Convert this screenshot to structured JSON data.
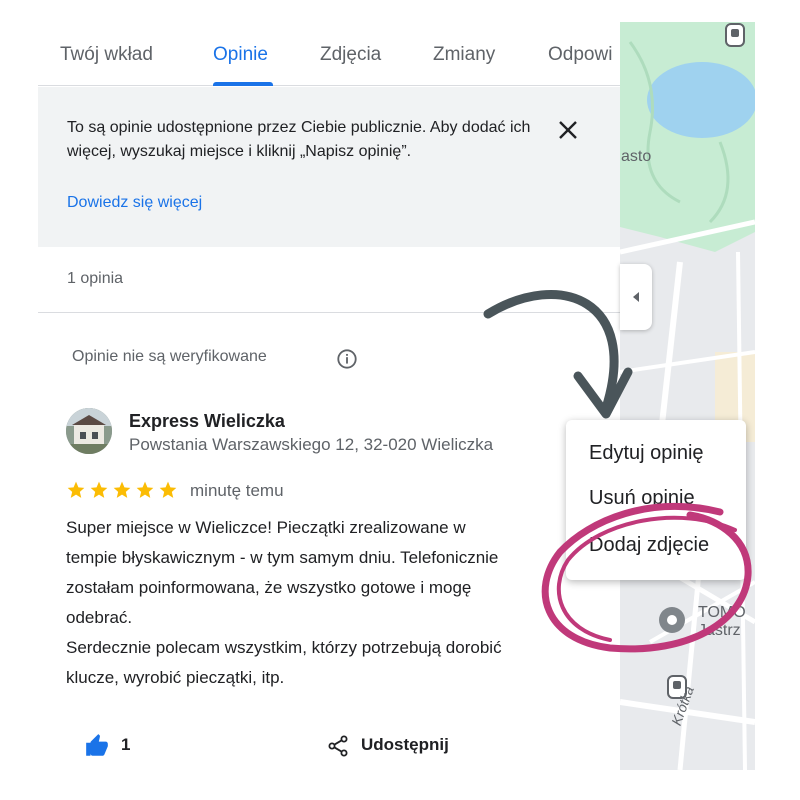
{
  "tabs": [
    {
      "label": "Twój wkład"
    },
    {
      "label": "Opinie"
    },
    {
      "label": "Zdjęcia"
    },
    {
      "label": "Zmiany"
    },
    {
      "label": "Odpowi"
    }
  ],
  "active_tab": "Opinie",
  "notice": {
    "text": "To są opinie udostępnione przez Ciebie publicznie. Aby dodać ich więcej, wyszukaj miejsce i kliknij „Napisz opinię”.",
    "link": "Dowiedz się więcej",
    "close_icon": "close-icon"
  },
  "reviews_count": "1 opinia",
  "unverified_note": "Opinie nie są weryfikowane",
  "review": {
    "place_name": "Express Wieliczka",
    "address": "Powstania Warszawskiego 12, 32-020 Wieliczka",
    "rating": 5,
    "time": "minutę temu",
    "text": "Super miejsce w Wieliczce! Pieczątki zrealizowane w\ntempie błyskawicznym - w tym samym dniu. Telefonicznie\nzostałam poinformowana, że wszystko gotowe i mogę\nodebrać.\nSerdecznie polecam wszystkim, którzy potrzebują dorobić\nklucze, wyrobić pieczątki, itp.",
    "likes": "1",
    "share_label": "Udostępnij"
  },
  "menu": {
    "items": [
      {
        "label": "Edytuj opinię"
      },
      {
        "label": "Usuń opinię"
      },
      {
        "label": "Dodaj zdjęcie"
      }
    ]
  },
  "map": {
    "label_asto": "asto",
    "label_place": "TOMO",
    "label_place2": "Jastrz",
    "label_street": "Krótka",
    "label_c": "c"
  },
  "colors": {
    "accent": "#1a73e8",
    "star": "#fbbc04",
    "annotation_arrow": "#4a555a",
    "annotation_circle": "#c0397a",
    "map_park": "#c7ecd3",
    "map_water": "#9fd2ef"
  }
}
